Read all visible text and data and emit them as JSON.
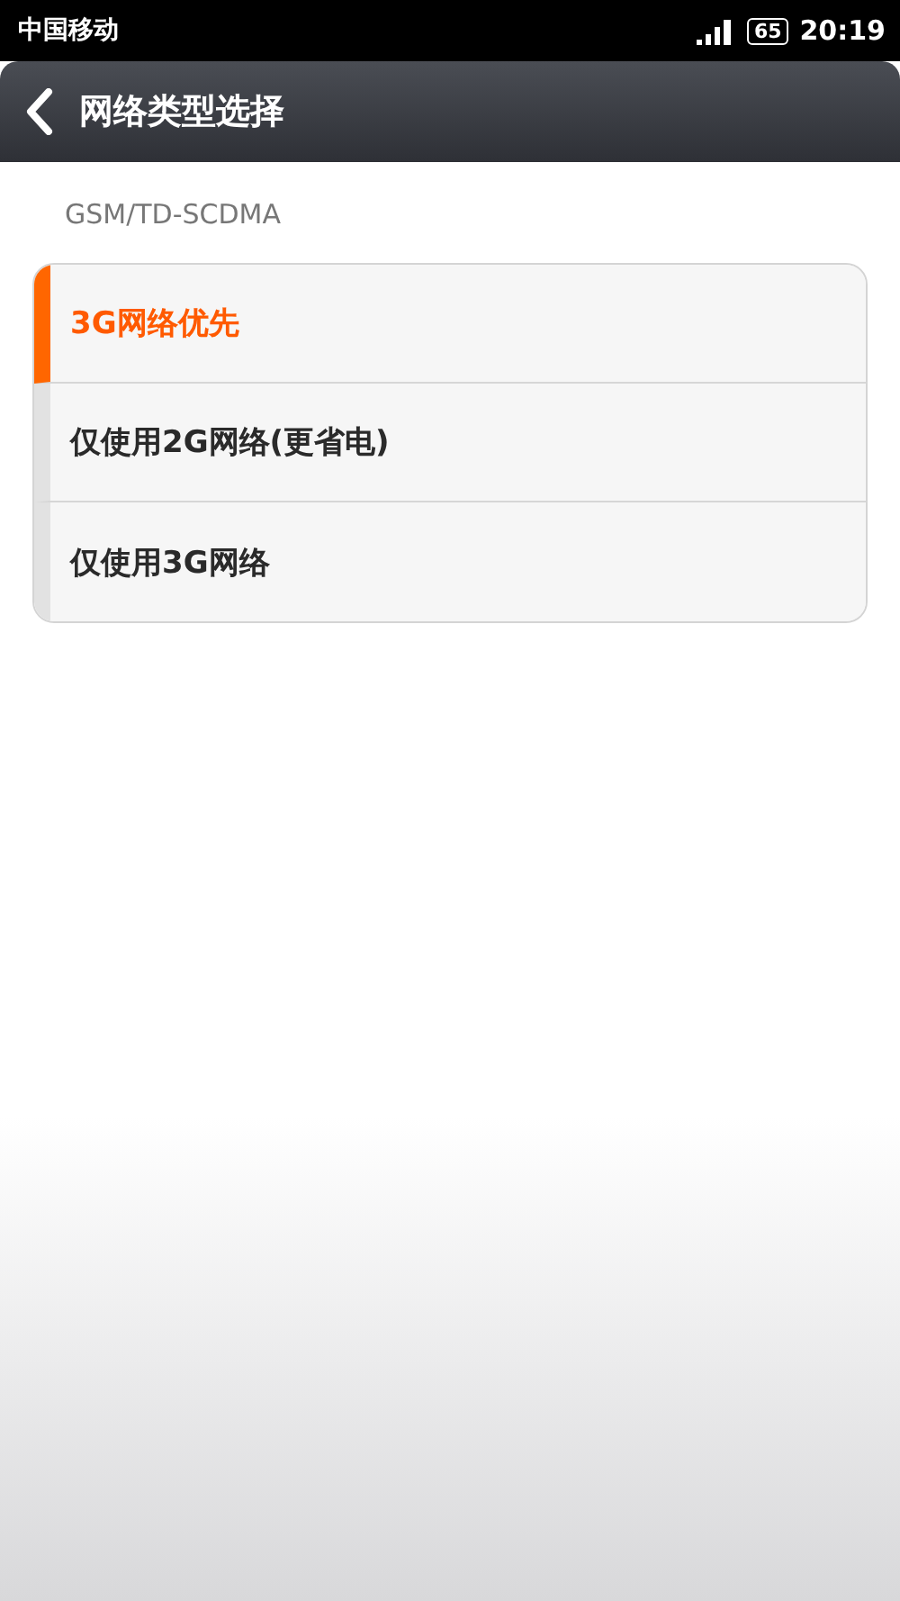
{
  "status_bar": {
    "carrier": "中国移动",
    "battery": "65",
    "time": "20:19"
  },
  "title_bar": {
    "title": "网络类型选择"
  },
  "section": {
    "header": "GSM/TD-SCDMA"
  },
  "options": [
    {
      "label": "3G网络优先",
      "selected": true
    },
    {
      "label": "仅使用2G网络(更省电)",
      "selected": false
    },
    {
      "label": "仅使用3G网络",
      "selected": false
    }
  ]
}
